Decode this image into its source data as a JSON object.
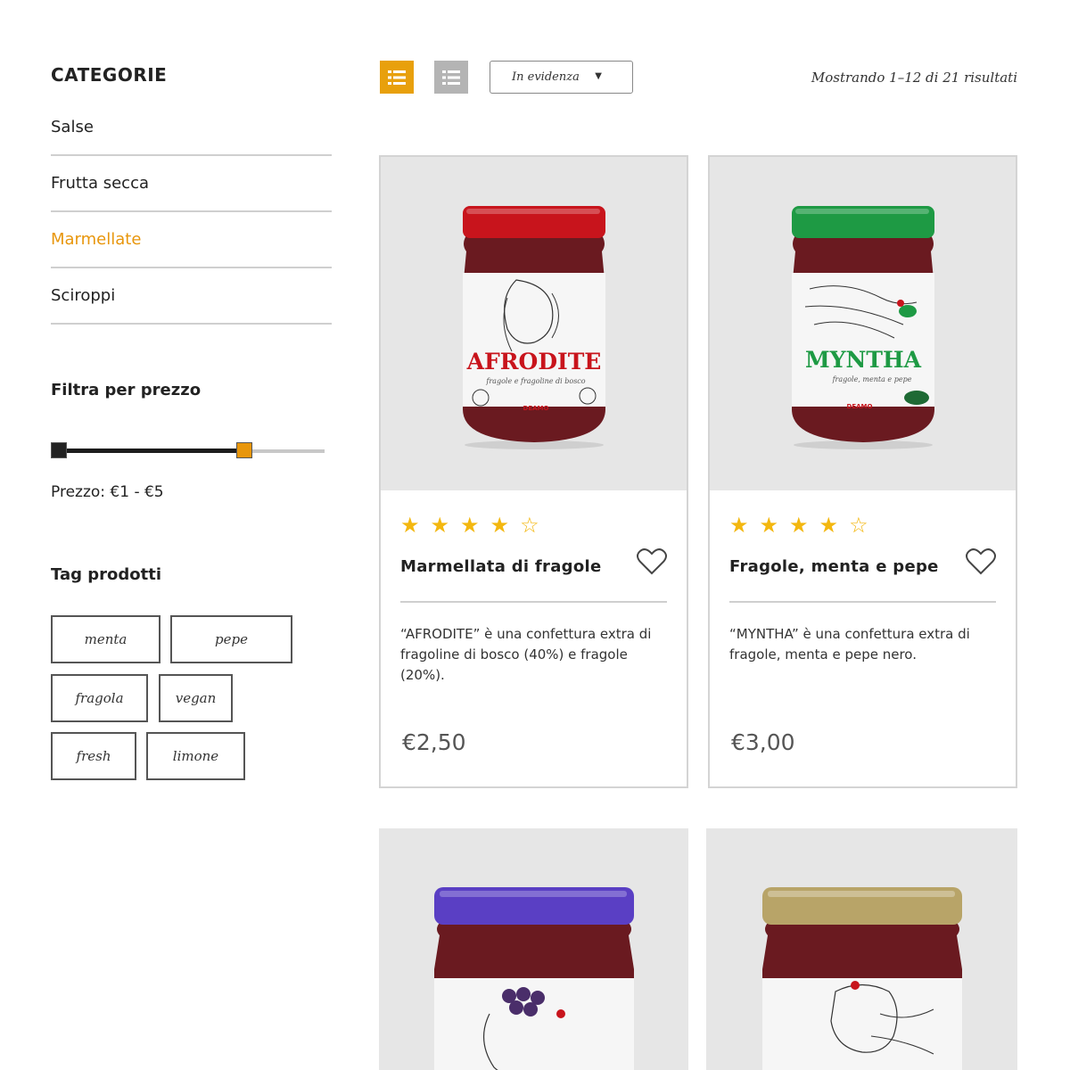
{
  "sidebar": {
    "categories_title": "CATEGORIE",
    "categories": [
      {
        "label": "Salse",
        "active": false
      },
      {
        "label": "Frutta secca",
        "active": false
      },
      {
        "label": "Marmellate",
        "active": true
      },
      {
        "label": "Sciroppi",
        "active": false
      }
    ],
    "price_filter_title": "Filtra per prezzo",
    "price_range": {
      "min": 1,
      "max": 5,
      "selected_min": 1,
      "selected_max": 5,
      "max_handle_fraction": 0.72
    },
    "price_label": "Prezzo: €1 - €5",
    "tags_title": "Tag prodotti",
    "tags": [
      "menta",
      "pepe",
      "fragola",
      "vegan",
      "fresh",
      "limone"
    ]
  },
  "toolbar": {
    "sort_value": "In evidenza",
    "results_text": "Mostrando 1–12 di 21 risultati",
    "active_view": "grid"
  },
  "products": [
    {
      "name": "Marmellata di fragole",
      "rating": 4,
      "rating_max": 5,
      "description": "“AFRODITE” è una confettura extra di fragoline di bosco (40%) e fragole (20%).",
      "price": "€2,50",
      "jar": {
        "label": "AFRODITE",
        "subtitle": "fragole e fragoline di bosco",
        "brand": "DEAMO",
        "lid_color": "#c8141c",
        "label_color": "#c8141c"
      }
    },
    {
      "name": "Fragole, menta e pepe",
      "rating": 4,
      "rating_max": 5,
      "description": "“MYNTHA” è una confettura extra di fragole, menta e pepe nero.",
      "price": "€3,00",
      "jar": {
        "label": "MYNTHA",
        "subtitle": "fragole, menta e pepe",
        "brand": "DEAMO",
        "lid_color": "#1e9a44",
        "label_color": "#1e9a44"
      }
    },
    {
      "jar": {
        "lid_color": "#5a3fc4"
      }
    },
    {
      "jar": {
        "lid_color": "#b8a468"
      }
    }
  ],
  "colors": {
    "accent": "#e8960c",
    "star": "#f3b70f",
    "jam": "#6a1a20",
    "card_image_bg": "#e6e6e6"
  }
}
